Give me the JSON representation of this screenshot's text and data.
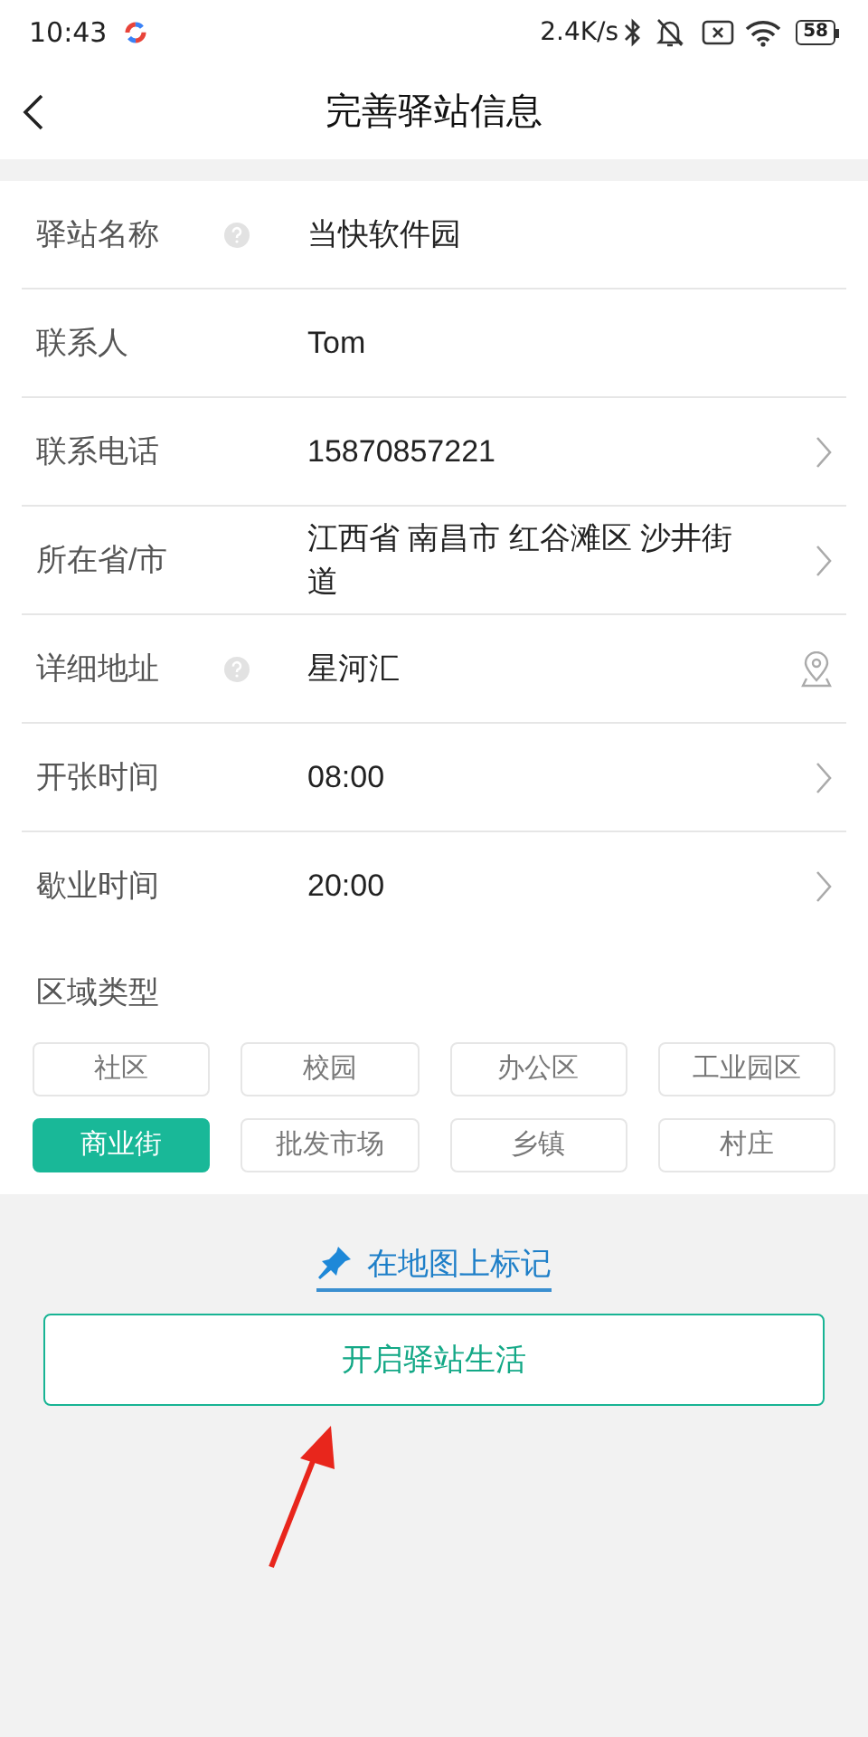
{
  "status_bar": {
    "time": "10:43",
    "speed": "2.4K/s",
    "battery": "58"
  },
  "header": {
    "title": "完善驿站信息"
  },
  "rows": [
    {
      "label": "驿站名称",
      "value": "当快软件园",
      "help": true,
      "kind": "plain"
    },
    {
      "label": "联系人",
      "value": "Tom",
      "help": false,
      "kind": "plain"
    },
    {
      "label": "联系电话",
      "value": "15870857221",
      "help": false,
      "kind": "chevron"
    },
    {
      "label": "所在省/市",
      "value": "江西省 南昌市 红谷滩区 沙井街道",
      "help": false,
      "kind": "chevron"
    },
    {
      "label": "详细地址",
      "value": "星河汇",
      "help": true,
      "kind": "location"
    },
    {
      "label": "开张时间",
      "value": "08:00",
      "help": false,
      "kind": "chevron"
    },
    {
      "label": "歇业时间",
      "value": "20:00",
      "help": false,
      "kind": "chevron"
    }
  ],
  "area_type": {
    "label": "区域类型",
    "options": [
      {
        "label": "社区",
        "selected": false
      },
      {
        "label": "校园",
        "selected": false
      },
      {
        "label": "办公区",
        "selected": false
      },
      {
        "label": "工业园区",
        "selected": false
      },
      {
        "label": "商业街",
        "selected": true
      },
      {
        "label": "批发市场",
        "selected": false
      },
      {
        "label": "乡镇",
        "selected": false
      },
      {
        "label": "村庄",
        "selected": false
      }
    ]
  },
  "map_link": "在地图上标记",
  "submit_button": "开启驿站生活"
}
